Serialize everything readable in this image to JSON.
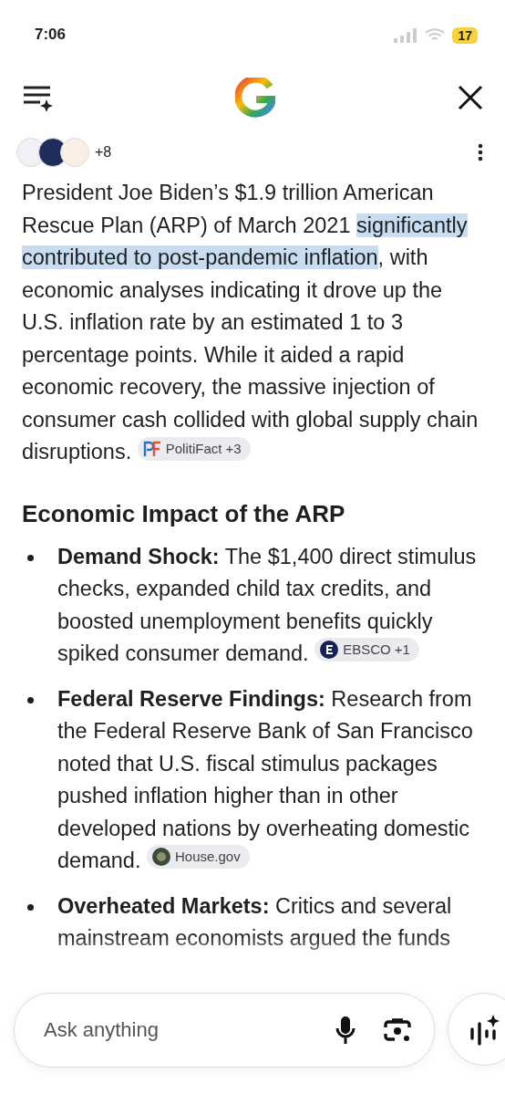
{
  "status_bar": {
    "time": "7:06",
    "battery": "17"
  },
  "header": {
    "sources_more": "+8"
  },
  "summary": {
    "parts": [
      {
        "text": "President Joe Biden’s $1.9 trillion American Rescue Plan (ARP) of March 2021 ",
        "selected": false
      },
      {
        "text": "significantly contributed to post-pandemic inflation",
        "selected": true
      },
      {
        "text": ", with economic analyses indicating it drove up the U.S. inflation rate by an estimated 1 to 3 percentage points. While it aided a rapid economic recovery, the massive injection of consumer cash collided with global supply chain disruptions.",
        "selected": false
      }
    ],
    "chip": {
      "label": "PolitiFact +3",
      "kind": "politifact"
    }
  },
  "section_title": "Economic Impact of the ARP",
  "bullets": [
    {
      "text": "**Demand Shock:** The $1,400 direct stimulus checks, expanded child tax credits, and boosted unemployment benefits quickly spiked consumer demand.",
      "chip": {
        "label": "EBSCO +1",
        "kind": "ebsco"
      }
    },
    {
      "text": "**Federal Reserve Findings:** Research from the Federal Reserve Bank of San Francisco noted that U.S. fiscal stimulus packages pushed inflation higher than in other developed nations by overheating domestic demand.",
      "chip": {
        "label": "House.gov",
        "kind": "house"
      }
    },
    {
      "text": "**Overheated Markets:** Critics and several mainstream economists argued the funds"
    }
  ],
  "ask": {
    "placeholder": "Ask anything"
  }
}
